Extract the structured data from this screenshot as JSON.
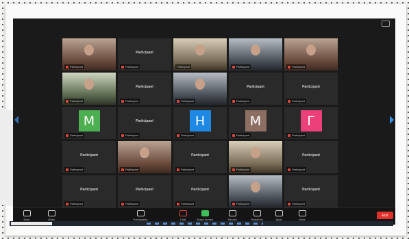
{
  "window": {
    "title": "",
    "colors": {
      "background": "#1a1a1a",
      "tile": "#2a2a2a",
      "active_speaker": "#9ed35c",
      "muted": "#e0463c",
      "end": "#e0302a"
    }
  },
  "tiles": [
    {
      "kind": "video",
      "label": "Participant",
      "muted": true
    },
    {
      "kind": "name",
      "name": "Participant",
      "label": "Participant",
      "muted": true
    },
    {
      "kind": "video",
      "label": "Participant",
      "muted": false,
      "active": true
    },
    {
      "kind": "video",
      "label": "Participant",
      "muted": true
    },
    {
      "kind": "video",
      "label": "Participant",
      "muted": true
    },
    {
      "kind": "video",
      "label": "Participant",
      "muted": true
    },
    {
      "kind": "name",
      "name": "Participant",
      "label": "Participant",
      "muted": true
    },
    {
      "kind": "video",
      "label": "Participant",
      "muted": true
    },
    {
      "kind": "name",
      "name": "Participant",
      "label": "Participant",
      "muted": true
    },
    {
      "kind": "name",
      "name": "Participant",
      "label": "Participant",
      "muted": true
    },
    {
      "kind": "avatar",
      "letter": "M",
      "avatar_color": "#4caf50",
      "label": "Participant",
      "muted": true
    },
    {
      "kind": "name",
      "name": "Participant",
      "label": "Participant",
      "muted": true
    },
    {
      "kind": "avatar",
      "letter": "H",
      "avatar_color": "#1e88e5",
      "label": "Participant",
      "muted": true
    },
    {
      "kind": "avatar",
      "letter": "M",
      "avatar_color": "#8d6e63",
      "label": "Participant",
      "muted": true
    },
    {
      "kind": "avatar",
      "letter": "Г",
      "avatar_color": "#ec407a",
      "label": "Participant",
      "muted": true
    },
    {
      "kind": "name",
      "name": "Participant",
      "label": "Participant",
      "muted": true
    },
    {
      "kind": "video",
      "label": "Participant",
      "muted": true
    },
    {
      "kind": "name",
      "name": "Participant",
      "label": "Participant",
      "muted": true
    },
    {
      "kind": "video",
      "label": "Participant",
      "muted": true
    },
    {
      "kind": "name",
      "name": "Participant",
      "label": "Participant",
      "muted": true
    },
    {
      "kind": "name",
      "name": "Participant",
      "label": "Participant",
      "muted": true
    },
    {
      "kind": "name",
      "name": "Participant",
      "label": "Participant",
      "muted": true
    },
    {
      "kind": "name",
      "name": "Participant",
      "label": "Participant",
      "muted": true
    },
    {
      "kind": "video",
      "label": "Participant",
      "muted": true
    },
    {
      "kind": "name",
      "name": "Participant",
      "label": "Participant",
      "muted": true
    }
  ],
  "toolbar": {
    "items": [
      {
        "icon": "microphone-icon",
        "label": "Mute"
      },
      {
        "icon": "video-camera-icon",
        "label": "Video"
      },
      {
        "icon": "participants-icon",
        "label": "Participants"
      },
      {
        "icon": "chat-icon",
        "label": "Chat"
      },
      {
        "icon": "share-screen-icon",
        "label": "Share Screen"
      },
      {
        "icon": "record-icon",
        "label": "Record"
      },
      {
        "icon": "reactions-icon",
        "label": "Reactions"
      },
      {
        "icon": "apps-icon",
        "label": "Apps"
      },
      {
        "icon": "more-icon",
        "label": "More"
      }
    ],
    "end_label": "End"
  }
}
